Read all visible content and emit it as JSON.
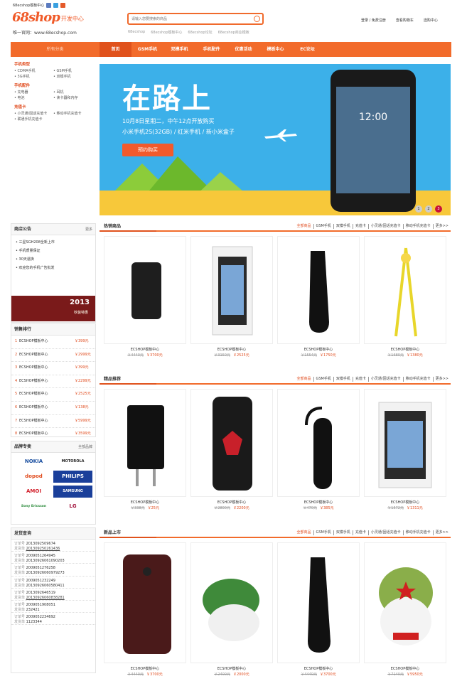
{
  "topbar": {
    "welcome": "68ecshop模板中心"
  },
  "logo": {
    "brand": "68shop",
    "suffix": "开发中心",
    "site": "唯一官网：www.68ecshop.com"
  },
  "search": {
    "placeholder": "请输入您要搜索的商品"
  },
  "hot_keywords": [
    "68ecshop",
    "68ecshop模板中心",
    "68ecshop论坛",
    "68ecshop商业模板"
  ],
  "top_links": [
    "登录",
    "免费注册",
    "查看购物车",
    "选购中心"
  ],
  "nav": {
    "all": "所有分类",
    "items": [
      "首页",
      "GSM手机",
      "双模手机",
      "手机配件",
      "优惠活动",
      "模板中心",
      "EC论坛"
    ]
  },
  "categories": [
    {
      "title": "手机类型",
      "items": [
        "CDMA手机",
        "GSM手机",
        "3G手机",
        "双模手机"
      ]
    },
    {
      "title": "手机配件",
      "items": [
        "充电器",
        "耳机",
        "电池",
        "读卡器和内存"
      ]
    },
    {
      "title": "充值卡",
      "items": [
        "小灵通/固话充值卡",
        "移动手机充值卡",
        "联通手机充值卡"
      ]
    }
  ],
  "banner": {
    "title": "在路上",
    "date": "10月8日星期二，中午12点开放购买",
    "line": "小米手机2S(32GB) / 红米手机 / 新小米盒子",
    "button": "预约购买",
    "clock": "12:00",
    "dots": [
      "1",
      "2",
      "3"
    ]
  },
  "notice": {
    "title": "商店公告",
    "more": "更多",
    "items": [
      "三星SGH208全新上市",
      "手机质量保证",
      "30天退换",
      "欢迎您的手机广告批发"
    ]
  },
  "promo": {
    "year": "2013",
    "slogan": "秋装特惠"
  },
  "ranking": {
    "title": "销售排行",
    "items": [
      {
        "no": "1",
        "name": "ECSHOP模板中心",
        "price": "￥399元"
      },
      {
        "no": "2",
        "name": "ECSHOP模板中心",
        "price": "￥2999元"
      },
      {
        "no": "3",
        "name": "ECSHOP模板中心",
        "price": "￥399元"
      },
      {
        "no": "4",
        "name": "ECSHOP模板中心",
        "price": "￥2299元"
      },
      {
        "no": "5",
        "name": "ECSHOP模板中心",
        "price": "￥2525元"
      },
      {
        "no": "6",
        "name": "ECSHOP模板中心",
        "price": "￥138元"
      },
      {
        "no": "7",
        "name": "ECSHOP模板中心",
        "price": "￥5999元"
      },
      {
        "no": "8",
        "name": "ECSHOP模板中心",
        "price": "￥3599元"
      }
    ]
  },
  "brands": {
    "title": "品牌专卖",
    "more": "全部品牌",
    "items": [
      "NOKIA",
      "MOTOROLA",
      "dopod",
      "PHILIPS",
      "AMOI",
      "SAMSUNG",
      "Sony Ericsson",
      "LG"
    ]
  },
  "orders": {
    "title": "发货查询",
    "rows": [
      {
        "label": "订单号",
        "id": "2013092509674",
        "label2": "发货单",
        "ship": "201309250261436"
      },
      {
        "label": "订单号",
        "id": "2009051264945",
        "label2": "发货单",
        "ship": "20130926061090203"
      },
      {
        "label": "订单号",
        "id": "2009051276258",
        "label2": "发货单",
        "ship": "20130926060979273"
      },
      {
        "label": "订单号",
        "id": "2009051232249",
        "label2": "发货单",
        "ship": "20130926060580411"
      },
      {
        "label": "订单号",
        "id": "2013092646519",
        "label2": "发货单",
        "ship": "20130926060838281"
      },
      {
        "label": "订单号",
        "id": "2009051908051",
        "label2": "发货单",
        "ship": "232421"
      },
      {
        "label": "订单号",
        "id": "2009052234692",
        "label2": "发货单",
        "ship": "1123344"
      }
    ]
  },
  "sections": [
    {
      "title": "热销商品",
      "tabs": [
        "全部商品",
        "GSM手机",
        "双模手机",
        "充值卡",
        "小灵通/固话充值卡",
        "移动手机充值卡",
        "更多>>"
      ],
      "products": [
        {
          "name": "ECSHOP模板中心",
          "old": "￥4440元",
          "price": "￥3700元",
          "icon": "phone-case-icon"
        },
        {
          "name": "ECSHOP模板中心",
          "old": "￥3150元",
          "price": "￥2525元",
          "icon": "phone-card-icon"
        },
        {
          "name": "ECSHOP模板中心",
          "old": "￥1554元",
          "price": "￥1750元",
          "icon": "car-charger-icon"
        },
        {
          "name": "ECSHOP模板中心",
          "old": "￥1680元",
          "price": "￥1380元",
          "icon": "lanyard-icon"
        }
      ]
    },
    {
      "title": "精品推荐",
      "tabs": [
        "全部商品",
        "GSM手机",
        "双模手机",
        "充值卡",
        "小灵通/固话充值卡",
        "移动手机充值卡",
        "更多>>"
      ],
      "products": [
        {
          "name": "ECSHOP模板中心",
          "old": "￥338元",
          "price": "￥25元",
          "icon": "wall-charger-icon"
        },
        {
          "name": "ECSHOP模板中心",
          "old": "￥2800元",
          "price": "￥2200元",
          "icon": "armor-case-icon"
        },
        {
          "name": "ECSHOP模板中心",
          "old": "￥470元",
          "price": "￥385元",
          "icon": "headset-icon"
        },
        {
          "name": "ECSHOP模板中心",
          "old": "￥1572元",
          "price": "￥1311元",
          "icon": "phone-card-icon"
        }
      ]
    },
    {
      "title": "新品上市",
      "tabs": [
        "全部商品",
        "GSM手机",
        "双模手机",
        "充值卡",
        "小灵通/固话充值卡",
        "移动手机充值卡",
        "更多>>"
      ],
      "products": [
        {
          "name": "ECSHOP模板中心",
          "old": "￥4440元",
          "price": "￥3700元",
          "icon": "phone-icon"
        },
        {
          "name": "ECSHOP模板中心",
          "old": "￥2400元",
          "price": "￥2000元",
          "icon": "plush-toy-icon"
        },
        {
          "name": "ECSHOP模板中心",
          "old": "￥4440元",
          "price": "￥3700元",
          "icon": "car-charger-icon"
        },
        {
          "name": "ECSHOP模板中心",
          "old": "￥7140元",
          "price": "￥5950元",
          "icon": "mitu-toy-icon"
        }
      ]
    }
  ]
}
